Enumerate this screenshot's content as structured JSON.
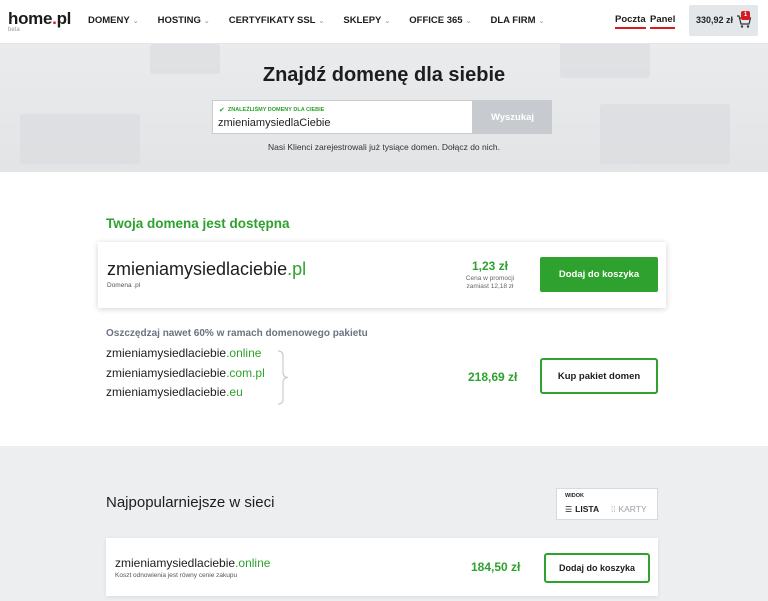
{
  "header": {
    "logo_main": "home",
    "logo_dot": ".",
    "logo_tld": "pl",
    "logo_sub": "beta",
    "nav": [
      {
        "label": "DOMENY"
      },
      {
        "label": "HOSTING"
      },
      {
        "label": "CERTYFIKATY SSL"
      },
      {
        "label": "SKLEPY"
      },
      {
        "label": "OFFICE 365"
      },
      {
        "label": "DLA FIRM"
      }
    ],
    "mail_link": "Poczta",
    "panel_link": "Panel",
    "cart_amount": "330,92 zł",
    "cart_count": "1"
  },
  "hero": {
    "title": "Znajdź domenę dla siebie",
    "found_label": "ZNALEŹLIŚMY DOMENY DLA CIEBIE",
    "search_value": "zmieniamysiedlaCiebie",
    "search_button": "Wyszukaj",
    "subtitle": "Nasi Klienci zarejestrowali już tysiące domen. Dołącz do nich."
  },
  "available": {
    "title": "Twoja domena jest dostępna",
    "domain_base": "zmieniamysiedlaciebie",
    "domain_ext": ".pl",
    "domain_sub": "Domena .pl",
    "price": "1,23 zł",
    "price_note_1": "Cena w promocji",
    "price_note_2": "zamiast 12,18 zł",
    "add_button": "Dodaj do koszyka"
  },
  "bundle": {
    "title": "Oszczędzaj nawet 60% w ramach domenowego pakietu",
    "items": [
      {
        "base": "zmieniamysiedlaciebie",
        "ext": ".online"
      },
      {
        "base": "zmieniamysiedlaciebie",
        "ext": ".com.pl"
      },
      {
        "base": "zmieniamysiedlaciebie",
        "ext": ".eu"
      }
    ],
    "price": "218,69 zł",
    "button": "Kup pakiet domen"
  },
  "popular": {
    "title": "Najpopularniejsze w sieci",
    "view_label": "WIDOK",
    "view_list": "LISTA",
    "view_cards": "KARTY",
    "item": {
      "base": "zmieniamysiedlaciebie",
      "ext": ".online",
      "sub": "Koszt odnowienia jest równy cenie zakupu",
      "price": "184,50 zł",
      "button": "Dodaj do koszyka"
    }
  },
  "colors": {
    "accent_green": "#2ea12e",
    "brand_red": "#d71920"
  }
}
